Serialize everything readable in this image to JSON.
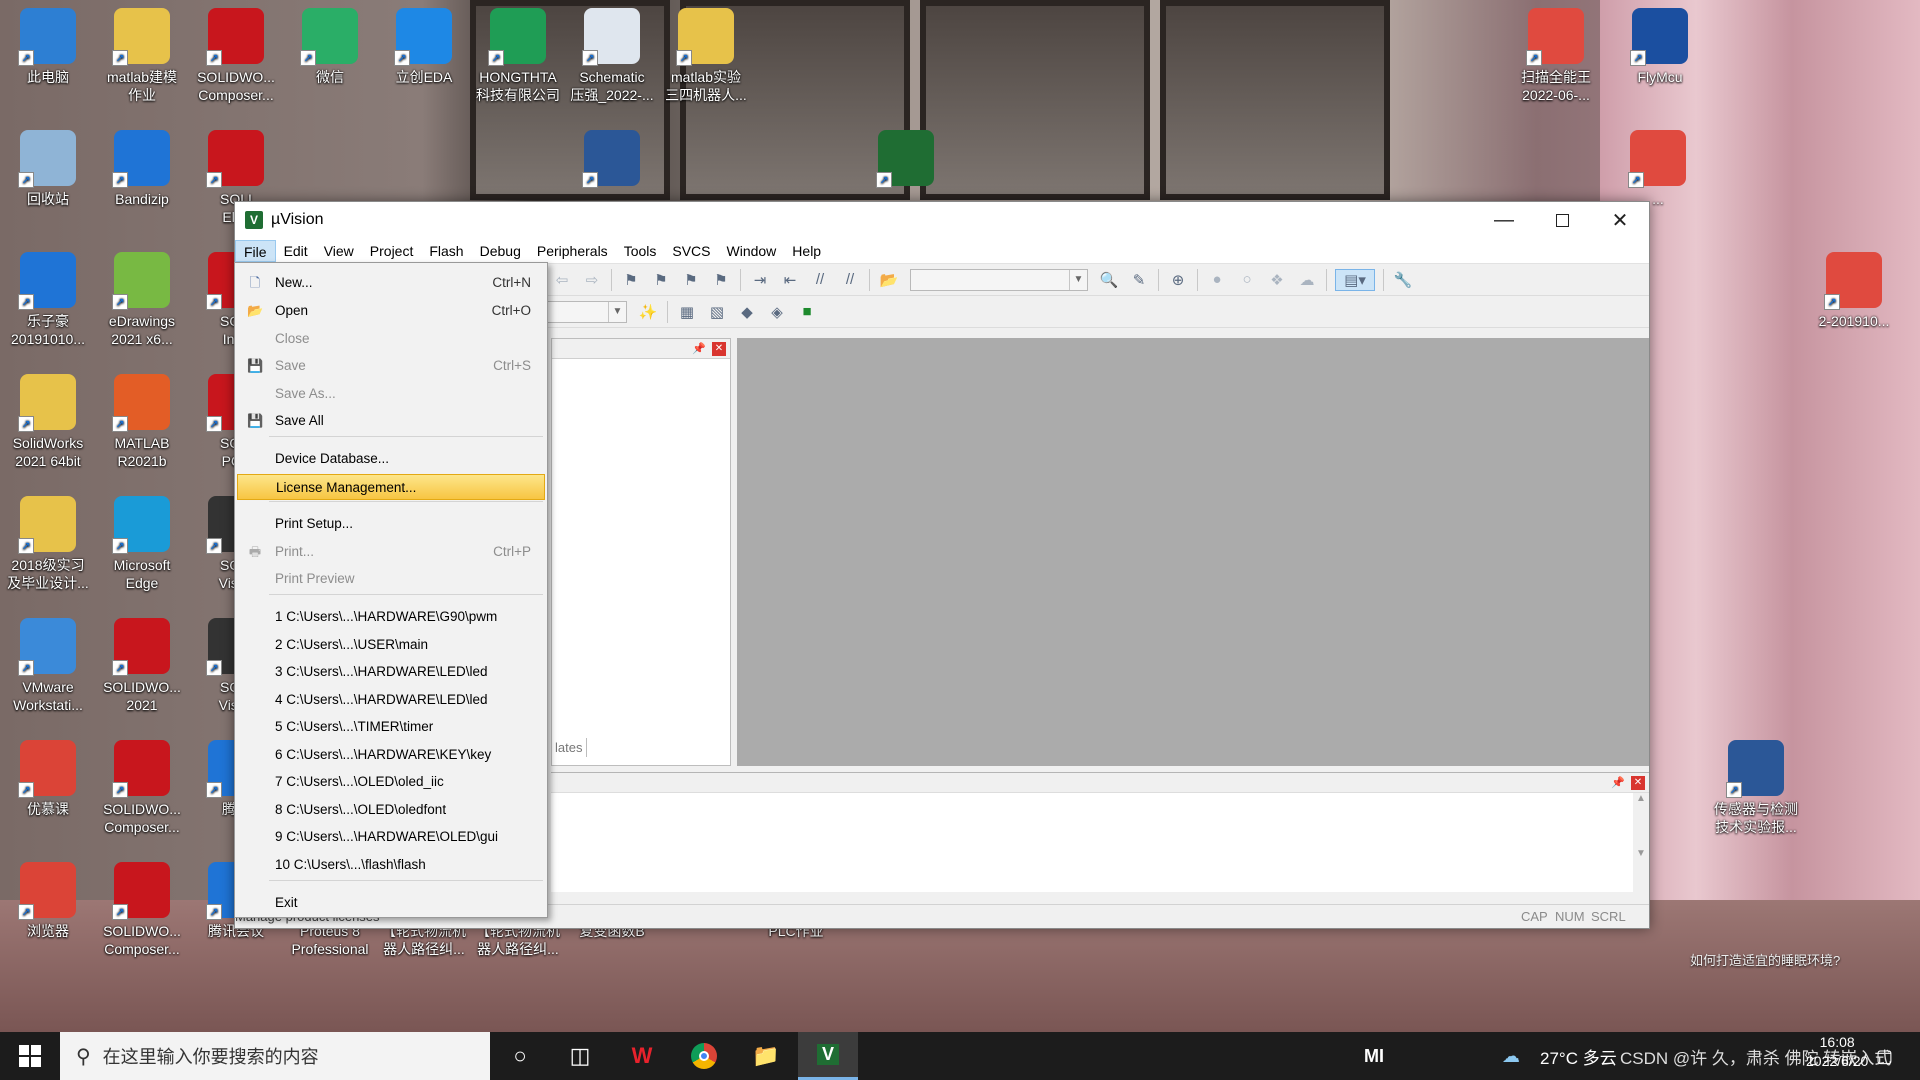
{
  "window": {
    "title": "µVision",
    "app_icon": "V",
    "menu": [
      "File",
      "Edit",
      "View",
      "Project",
      "Flash",
      "Debug",
      "Peripherals",
      "Tools",
      "SVCS",
      "Window",
      "Help"
    ],
    "open_menu": "File",
    "project_tab_label": "lates",
    "status": {
      "hint": "Manage product licenses",
      "cap": "CAP",
      "num": "NUM",
      "scrl": "SCRL"
    }
  },
  "file_menu": {
    "items": [
      {
        "label": "New...",
        "shortcut": "Ctrl+N",
        "icon": "new-file-icon",
        "enabled": true
      },
      {
        "label": "Open",
        "shortcut": "Ctrl+O",
        "icon": "open-folder-icon",
        "enabled": true
      },
      {
        "label": "Close",
        "shortcut": "",
        "icon": "",
        "enabled": false
      },
      {
        "label": "Save",
        "shortcut": "Ctrl+S",
        "icon": "save-icon",
        "enabled": false
      },
      {
        "label": "Save As...",
        "shortcut": "",
        "icon": "",
        "enabled": false
      },
      {
        "label": "Save All",
        "shortcut": "",
        "icon": "save-all-icon",
        "enabled": true
      },
      {
        "label": "Device Database...",
        "shortcut": "",
        "icon": "",
        "enabled": true
      },
      {
        "label": "License Management...",
        "shortcut": "",
        "icon": "",
        "enabled": true,
        "highlighted": true
      },
      {
        "label": "Print Setup...",
        "shortcut": "",
        "icon": "",
        "enabled": true
      },
      {
        "label": "Print...",
        "shortcut": "Ctrl+P",
        "icon": "print-icon",
        "enabled": false
      },
      {
        "label": "Print Preview",
        "shortcut": "",
        "icon": "",
        "enabled": false
      },
      {
        "label": "1 C:\\Users\\...\\HARDWARE\\G90\\pwm",
        "shortcut": "",
        "icon": "",
        "enabled": true
      },
      {
        "label": "2 C:\\Users\\...\\USER\\main",
        "shortcut": "",
        "icon": "",
        "enabled": true
      },
      {
        "label": "3 C:\\Users\\...\\HARDWARE\\LED\\led",
        "shortcut": "",
        "icon": "",
        "enabled": true
      },
      {
        "label": "4 C:\\Users\\...\\HARDWARE\\LED\\led",
        "shortcut": "",
        "icon": "",
        "enabled": true
      },
      {
        "label": "5 C:\\Users\\...\\TIMER\\timer",
        "shortcut": "",
        "icon": "",
        "enabled": true
      },
      {
        "label": "6 C:\\Users\\...\\HARDWARE\\KEY\\key",
        "shortcut": "",
        "icon": "",
        "enabled": true
      },
      {
        "label": "7 C:\\Users\\...\\OLED\\oled_iic",
        "shortcut": "",
        "icon": "",
        "enabled": true
      },
      {
        "label": "8 C:\\Users\\...\\OLED\\oledfont",
        "shortcut": "",
        "icon": "",
        "enabled": true
      },
      {
        "label": "9 C:\\Users\\...\\HARDWARE\\OLED\\gui",
        "shortcut": "",
        "icon": "",
        "enabled": true
      },
      {
        "label": "10 C:\\Users\\...\\flash\\flash",
        "shortcut": "",
        "icon": "",
        "enabled": true
      },
      {
        "label": "Exit",
        "shortcut": "",
        "icon": "",
        "enabled": true
      }
    ]
  },
  "desktop_icons": [
    {
      "label": "此电脑",
      "icon": "computer-icon",
      "color": "#2d7fd3"
    },
    {
      "label": "matlab建模\n作业",
      "icon": "folder-icon",
      "color": "#e7c24a"
    },
    {
      "label": "SOLIDWO...\nComposer...",
      "icon": "solidworks-icon",
      "color": "#c8161d"
    },
    {
      "label": "微信",
      "icon": "wechat-icon",
      "color": "#2aae67"
    },
    {
      "label": "立创EDA",
      "icon": "cloud-icon",
      "color": "#1e88e5"
    },
    {
      "label": "HONGTHTA\n科技有限公司",
      "icon": "spreadsheet-icon",
      "color": "#1f9d55"
    },
    {
      "label": "Schematic\n压强_2022-...",
      "icon": "document-icon",
      "color": "#dfe6ee"
    },
    {
      "label": "matlab实验\n三四机器人...",
      "icon": "folder-icon",
      "color": "#e7c24a"
    },
    {
      "label": "扫描全能王\n2022-06-...",
      "icon": "pdf-icon",
      "color": "#e04a3f"
    },
    {
      "label": "FlyMcu",
      "icon": "bird-icon",
      "color": "#1b4fa0"
    },
    {
      "label": "回收站",
      "icon": "recycle-bin-icon",
      "color": "#8fb4d6"
    },
    {
      "label": "Bandizip",
      "icon": "bandizip-icon",
      "color": "#1f74d6"
    },
    {
      "label": "SOLI\nElec",
      "icon": "solidworks-icon",
      "color": "#c8161d"
    },
    {
      "label": "乐子豪\n20191010...",
      "icon": "zip-icon",
      "color": "#1f74d6"
    },
    {
      "label": "eDrawings\n2021 x6...",
      "icon": "edrawings-icon",
      "color": "#78b943"
    },
    {
      "label": "SOLI\nInsp",
      "icon": "solidworks-icon",
      "color": "#c8161d"
    },
    {
      "label": "SolidWorks\n2021 64bit",
      "icon": "folder-icon",
      "color": "#e7c24a"
    },
    {
      "label": "MATLAB\nR2021b",
      "icon": "matlab-icon",
      "color": "#e35d26"
    },
    {
      "label": "SOLI\nPCB",
      "icon": "solidworks-icon",
      "color": "#c8161d"
    },
    {
      "label": "2018级实习\n及毕业设计...",
      "icon": "folder-icon",
      "color": "#e7c24a"
    },
    {
      "label": "Microsoft\nEdge",
      "icon": "edge-icon",
      "color": "#1a9bd7"
    },
    {
      "label": "SOLI\nVisua",
      "icon": "solidworks-icon",
      "color": "#333333"
    },
    {
      "label": "VMware\nWorkstati...",
      "icon": "vmware-icon",
      "color": "#3b8ad9"
    },
    {
      "label": "SOLIDWO...\n2021",
      "icon": "solidworks-icon",
      "color": "#c8161d"
    },
    {
      "label": "SOLI\nVisua",
      "icon": "solidworks-icon",
      "color": "#333333"
    },
    {
      "label": "优慕课",
      "icon": "chrome-icon",
      "color": "#db4437"
    },
    {
      "label": "SOLIDWO...\nComposer...",
      "icon": "solidworks-icon",
      "color": "#c8161d"
    },
    {
      "label": "腾讯",
      "icon": "tencent-icon",
      "color": "#1f74d6"
    },
    {
      "label": "浏览器",
      "icon": "chrome-icon",
      "color": "#db4437"
    },
    {
      "label": "SOLIDWO...\nComposer...",
      "icon": "solidworks-icon",
      "color": "#c8161d"
    },
    {
      "label": "腾讯会议",
      "icon": "tencent-meeting-icon",
      "color": "#1f74d6"
    },
    {
      "label": "Proteus 8\nProfessional",
      "icon": "proteus-icon",
      "color": "#1f74d6"
    },
    {
      "label": "【轮式物流机\n器人路径纠...",
      "icon": "document-icon",
      "color": "#2b5797"
    },
    {
      "label": "【轮式物流机\n器人路径纠...",
      "icon": "document-icon",
      "color": "#2b5797"
    },
    {
      "label": "复变函数B",
      "icon": "document-icon",
      "color": "#2b5797"
    },
    {
      "label": "PLC作业",
      "icon": "folder-icon",
      "color": "#e7c24a"
    },
    {
      "label": "2-201910...",
      "icon": "pdf-icon",
      "color": "#e04a3f"
    },
    {
      "label": "传感器与检测\n技术实验报...",
      "icon": "word-icon",
      "color": "#2b5797"
    },
    {
      "label": "...",
      "icon": "pdf-icon",
      "color": "#e04a3f"
    },
    {
      "label": "...",
      "icon": "word-icon",
      "color": "#2b5797"
    },
    {
      "label": "...",
      "icon": "keil-icon",
      "color": "#1f6d33"
    }
  ],
  "taskbar": {
    "search_placeholder": "在这里输入你要搜索的内容",
    "weather": "27°C 多云",
    "time": "16:08",
    "date": "2022/6/20",
    "tray_logo": "MI",
    "watermark": "CSDN @许 久，肃杀 佛陀 转嵌入式"
  },
  "desktop_widget": {
    "question": "如何打造适宜的睡眠环境?"
  }
}
